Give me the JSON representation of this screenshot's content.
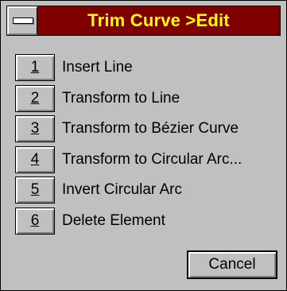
{
  "window": {
    "title": "Trim Curve >Edit"
  },
  "menu": {
    "items": [
      {
        "key": "1",
        "label": "Insert Line"
      },
      {
        "key": "2",
        "label": "Transform to Line"
      },
      {
        "key": "3",
        "label": "Transform to Bézier Curve"
      },
      {
        "key": "4",
        "label": "Transform to Circular Arc..."
      },
      {
        "key": "5",
        "label": "Invert Circular Arc"
      },
      {
        "key": "6",
        "label": "Delete Element"
      }
    ]
  },
  "buttons": {
    "cancel_label": "Cancel"
  },
  "colors": {
    "title_bar": "#800000",
    "title_text": "#ffff00",
    "face": "#c0c0c0"
  },
  "icons": {
    "system_menu": "system-menu-icon"
  }
}
